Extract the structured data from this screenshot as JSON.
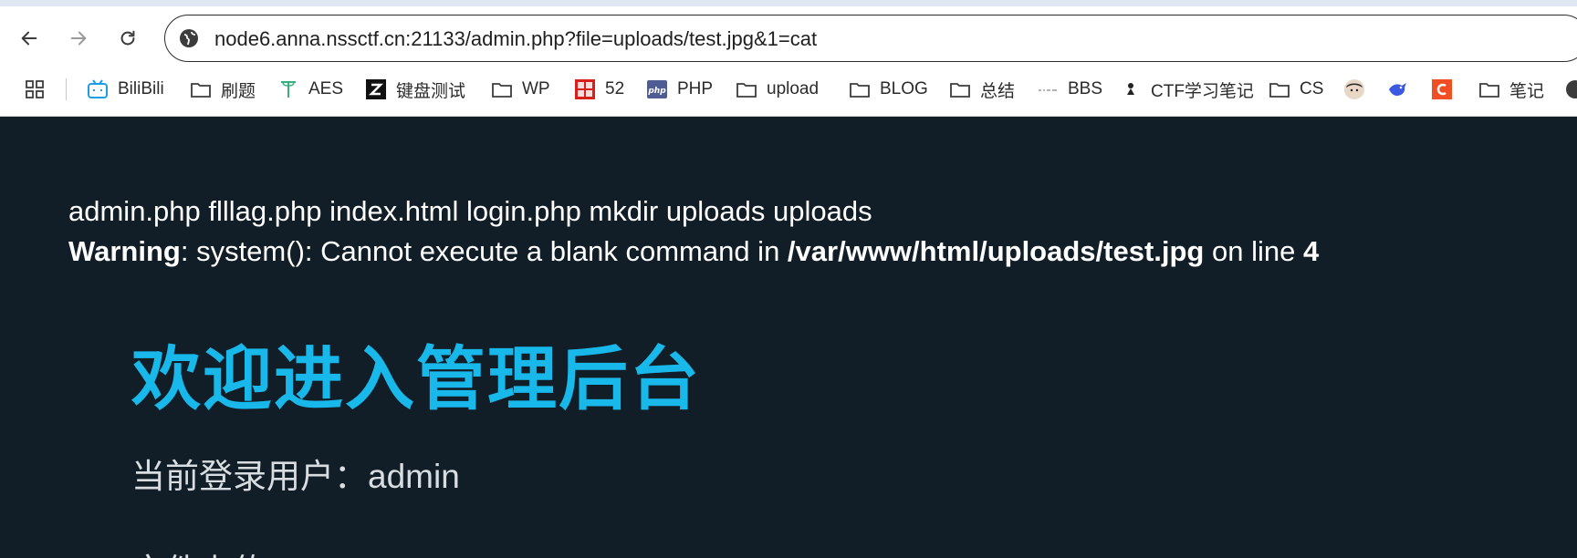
{
  "browser": {
    "url": "node6.anna.nssctf.cn:21133/admin.php?file=uploads/test.jpg&1=cat",
    "bookmarks": [
      {
        "label": "BiliBili",
        "icon": "bilibili-icon"
      },
      {
        "label": "刷题",
        "icon": "folder-icon"
      },
      {
        "label": "AES",
        "icon": "t-logo-icon"
      },
      {
        "label": "键盘测试",
        "icon": "z-logo-icon"
      },
      {
        "label": "WP",
        "icon": "folder-icon"
      },
      {
        "label": "52",
        "icon": "52pojie-icon"
      },
      {
        "label": "PHP",
        "icon": "php-icon"
      },
      {
        "label": "upload",
        "icon": "folder-icon"
      },
      {
        "label": "BLOG",
        "icon": "folder-icon"
      },
      {
        "label": "总结",
        "icon": "folder-icon"
      },
      {
        "label": "BBS",
        "icon": "bbs-icon"
      },
      {
        "label": "CTF学习笔记",
        "icon": "ctf-icon"
      },
      {
        "label": "CS",
        "icon": "folder-icon"
      },
      {
        "label": "",
        "icon": "avatar-icon"
      },
      {
        "label": "",
        "icon": "bird-icon"
      },
      {
        "label": "",
        "icon": "c-logo-icon"
      },
      {
        "label": "笔记",
        "icon": "folder-icon"
      }
    ]
  },
  "page": {
    "listing": "admin.php flllag.php index.html login.php mkdir uploads uploads",
    "warning_label": "Warning",
    "warning_mid": ": system(): Cannot execute a blank command in ",
    "warning_path": "/var/www/html/uploads/test.jpg",
    "warning_on_line": " on line ",
    "warning_line_no": "4",
    "title": "欢迎进入管理后台",
    "user_line": "当前登录用户：admin",
    "next_line": "文件上传"
  },
  "colors": {
    "page_bg": "#121e27",
    "title": "#18b8ea",
    "text": "#ffffff"
  }
}
